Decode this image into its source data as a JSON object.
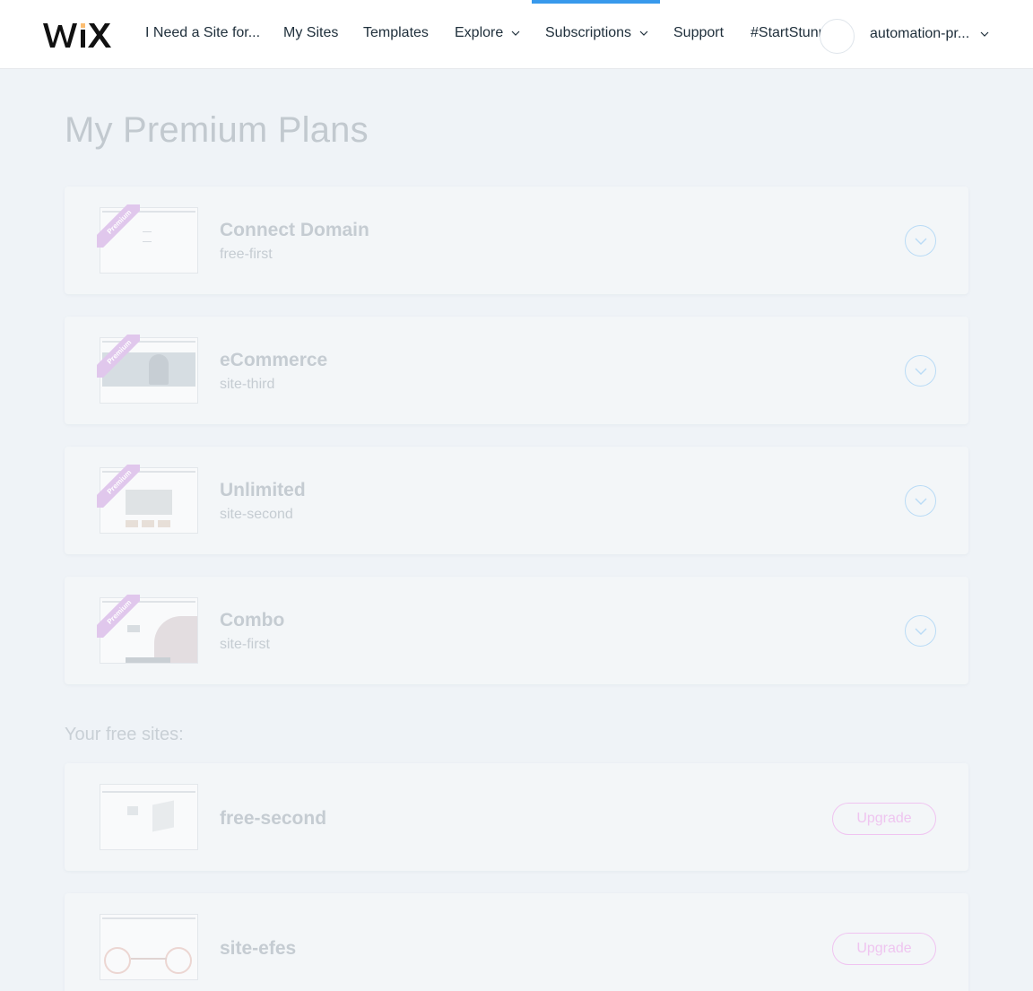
{
  "header": {
    "logo_text": "WiX",
    "nav": [
      {
        "label": "I Need a Site for...",
        "dropdown": false
      },
      {
        "label": "My Sites",
        "dropdown": false
      },
      {
        "label": "Templates",
        "dropdown": false
      },
      {
        "label": "Explore",
        "dropdown": true
      },
      {
        "label": "Subscriptions",
        "dropdown": true
      },
      {
        "label": "Support",
        "dropdown": false
      },
      {
        "label": "#StartStunning",
        "dropdown": false
      }
    ],
    "active_nav": "Subscriptions",
    "user_label": "automation-pr..."
  },
  "page": {
    "title": "My Premium Plans"
  },
  "premium_plans": [
    {
      "plan": "Connect Domain",
      "site": "free-first",
      "ribbon": "Premium"
    },
    {
      "plan": "eCommerce",
      "site": "site-third",
      "ribbon": "Premium"
    },
    {
      "plan": "Unlimited",
      "site": "site-second",
      "ribbon": "Premium"
    },
    {
      "plan": "Combo",
      "site": "site-first",
      "ribbon": "Premium"
    }
  ],
  "free_sites": {
    "label": "Your free sites:",
    "items": [
      {
        "site": "free-second",
        "button": "Upgrade"
      },
      {
        "site": "site-efes",
        "button": "Upgrade"
      }
    ]
  },
  "colors": {
    "accent": "#3899ec",
    "upgrade": "#efc5f0",
    "ribbon": "#e0c7ec",
    "background": "#eff3f7"
  },
  "icons": {
    "expand": "chevron-down-circle-icon",
    "dropdown": "chevron-down-icon"
  }
}
